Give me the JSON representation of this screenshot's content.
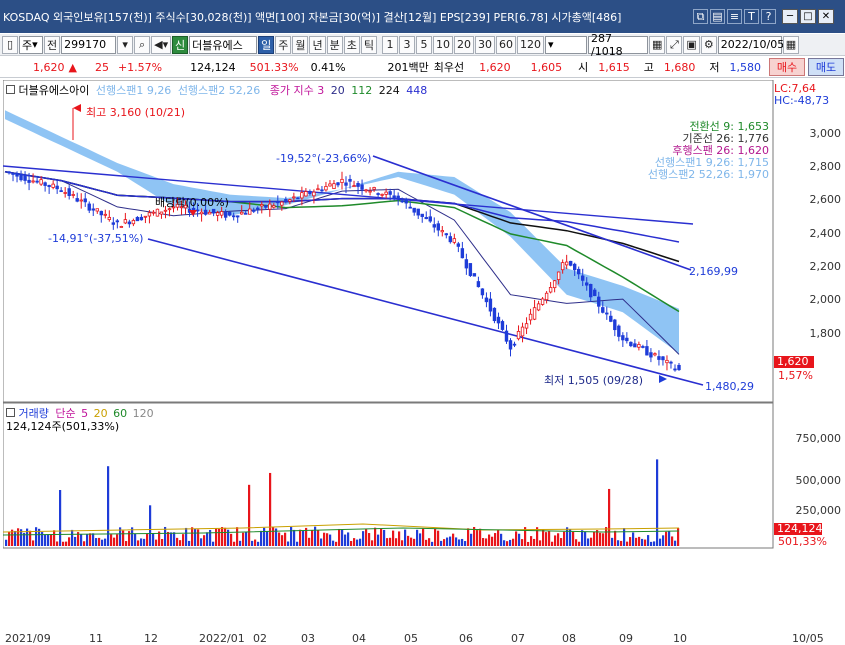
{
  "title_bar": {
    "title": "KOSDAQ 외국인보유[157(천)] 주식수[30,028(천)] 액면[100] 자본금[30(억)] 결산[12월] EPS[239] PER[6.78] 시가총액[486]",
    "icons": [
      "window-icon",
      "print-icon",
      "list-icon",
      "text-icon",
      "help-icon"
    ],
    "icon_glyphs": [
      "⧉",
      "▤",
      "≡",
      "T",
      "?"
    ]
  },
  "toolbar": {
    "market_select": "주",
    "prefix_label": "전",
    "code_value": "299170",
    "stock_badge": "신",
    "stock_name": "더블유에스",
    "periods": [
      "일",
      "주",
      "월",
      "년",
      "분",
      "초",
      "틱"
    ],
    "selected_period": "일",
    "interval_numbers": [
      "1",
      "3",
      "5",
      "10",
      "20",
      "30",
      "60",
      "120"
    ],
    "page_counter": "287 /1018",
    "date_value": "2022/10/05"
  },
  "price_bar": {
    "price": "1,620",
    "direction_icon": "▲",
    "change": "25",
    "change_pct": "+1.57%",
    "volume": "124,124",
    "volume_ratio": "501.33%",
    "turnover": "0.41%",
    "hold_label": "201백만",
    "preferred_label": "최우선",
    "ask": "1,620",
    "bid": "1,605",
    "open_label": "시",
    "open_value": "1,615",
    "high_label": "고",
    "high_value": "1,680",
    "low_label": "저",
    "low_value": "1,580",
    "buy_label": "매수",
    "sell_label": "매도"
  },
  "legend": {
    "stock": "더블유에스아이",
    "span1": "선행스팬1 9,26",
    "span2": "선행스팬2 52,26",
    "ma_label": "종가 지수 3",
    "ma_periods": [
      "20",
      "112",
      "224",
      "448"
    ],
    "lc": "LC:7,64",
    "hc": "HC:-48,73",
    "right_items": [
      "전환선 9: 1,653",
      "기준선 26: 1,776",
      "후행스팬 26: 1,620",
      "선행스팬1 9,26: 1,715",
      "선행스팬2 52,26: 1,970"
    ]
  },
  "annotations": {
    "high": "최고 3,160 (10/21)",
    "dividend": "배당락(0.00%)",
    "left_pct": "-14,91°(-37,51%)",
    "mid_pct": "-19,52°(-23,66%)",
    "low": "최저 1,505 (09/28)",
    "line1": "2,169,99",
    "line2": "1,480,29",
    "current_price": "1,620",
    "current_pct": "1,57%"
  },
  "volume_panel": {
    "title": "거래량",
    "simple_label": "단순",
    "ma_periods": [
      "5",
      "20",
      "60",
      "120"
    ],
    "value": "124,124주(501,33%)",
    "last_value": "124,124",
    "last_pct": "501,33%"
  },
  "y_axis": [
    "3,000",
    "2,800",
    "2,600",
    "2,400",
    "2,200",
    "2,000",
    "1,800"
  ],
  "vol_axis": [
    "750,000",
    "500,000",
    "250,000"
  ],
  "x_axis": [
    "2021/09",
    "11",
    "12",
    "2022/01",
    "02",
    "03",
    "04",
    "05",
    "06",
    "07",
    "08",
    "09",
    "10",
    "10/05"
  ],
  "chart_data": {
    "type": "line",
    "title": "더블유에스아이",
    "x": [
      "2021/09",
      "11",
      "12",
      "2022/01",
      "02",
      "03",
      "04",
      "05",
      "06",
      "07",
      "08",
      "09",
      "10"
    ],
    "series": [
      {
        "name": "종가",
        "values": [
          2750,
          2650,
          2450,
          2550,
          2500,
          2580,
          2700,
          2600,
          2350,
          1750,
          2250,
          1800,
          1620
        ]
      },
      {
        "name": "선행스팬1 9,26",
        "values": [
          3050,
          2900,
          2750,
          2550,
          2500,
          2560,
          2650,
          2720,
          2620,
          2380,
          2050,
          1950,
          1715
        ]
      },
      {
        "name": "선행스팬2 52,26",
        "values": [
          3100,
          2950,
          2800,
          2680,
          2620,
          2600,
          2650,
          2750,
          2720,
          2520,
          2200,
          2100,
          1970
        ]
      }
    ],
    "ylim": [
      1450,
      3250
    ],
    "grid": false,
    "legend_position": "top-left"
  },
  "colors": {
    "title_bg": "#2c4f86",
    "up": "#e8151b",
    "down": "#1e3cd8",
    "cloud": "#6ab0f0",
    "ma20": "#2e2e8a",
    "ma112": "#1f8a2a",
    "ma224": "#111111",
    "ma448": "#2a2fd0",
    "buy_bg": "#f7d2d0",
    "sell_bg": "#cfe0f7"
  }
}
